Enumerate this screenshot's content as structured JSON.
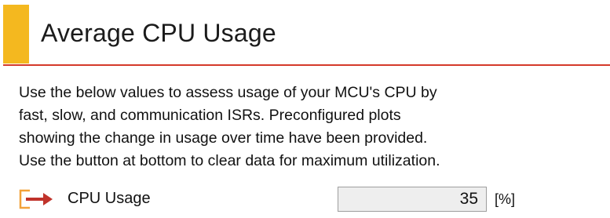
{
  "header": {
    "title": "Average CPU Usage",
    "accent_color": "#f4b81f",
    "rule_color": "#d43a2a"
  },
  "description": {
    "lines": [
      "Use the below values to assess usage of your MCU's CPU by",
      "fast, slow, and communication ISRs.  Preconfigured plots",
      "showing the change in usage over time have been provided.",
      "Use the button at bottom to clear data for maximum utilization."
    ]
  },
  "metrics": [
    {
      "icon": "link-arrow-icon",
      "label": "CPU Usage",
      "value": "35",
      "unit": "[%]"
    }
  ]
}
